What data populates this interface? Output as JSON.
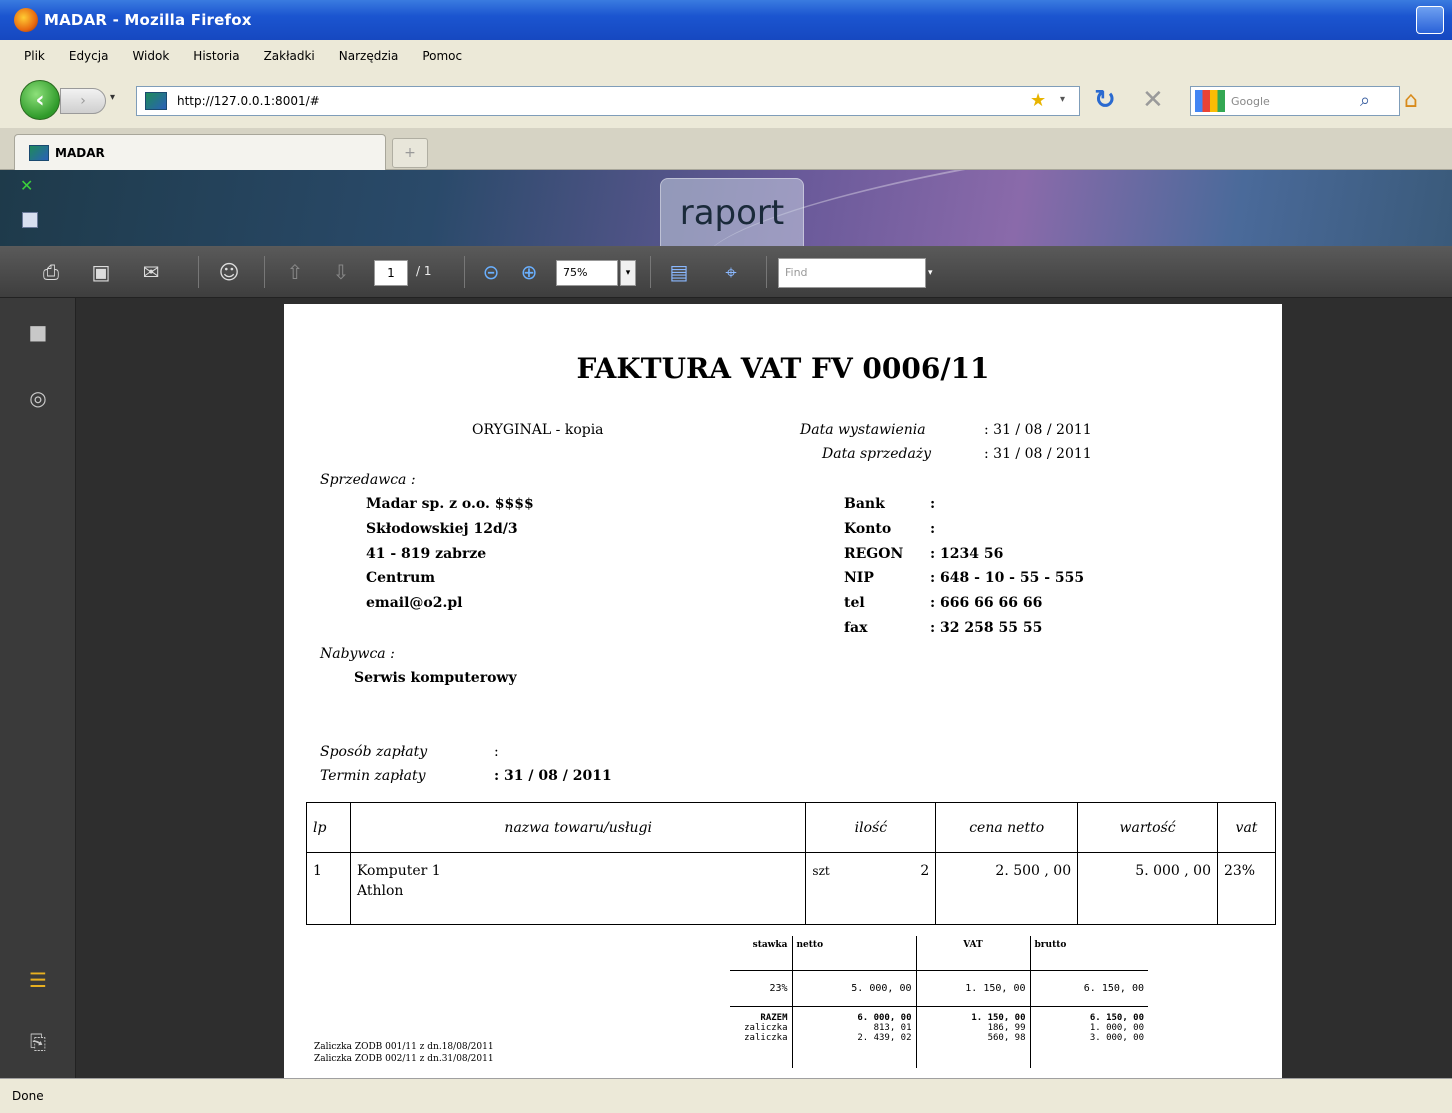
{
  "window": {
    "title": "MADAR - Mozilla Firefox"
  },
  "menu": [
    "Plik",
    "Edycja",
    "Widok",
    "Historia",
    "Zakładki",
    "Narzędzia",
    "Pomoc"
  ],
  "nav": {
    "url": "http://127.0.0.1:8001/#",
    "search_placeholder": "Google"
  },
  "tab": {
    "label": "MADAR",
    "new_tab": "+"
  },
  "app": {
    "section_title": "raport"
  },
  "pdf_toolbar": {
    "page_current": "1",
    "page_total": "/ 1",
    "zoom": "75%",
    "find_placeholder": "Find"
  },
  "invoice": {
    "title": "FAKTURA VAT FV 0006/11",
    "copy_label": "ORYGINAL   -  kopia",
    "issue_date_label": "Data wystawienia",
    "issue_date": ":  31 / 08 / 2011",
    "sale_date_label": "Data sprzedaży",
    "sale_date": ":  31 / 08 / 2011",
    "seller_label": "Sprzedawca :",
    "seller_lines": [
      "Madar sp. z o.o.  $$$$",
      "Skłodowskiej 12d/3",
      "41 - 819   zabrze",
      "Centrum",
      "email@o2.pl"
    ],
    "bank_labels": [
      "Bank",
      "Konto",
      "REGON",
      "NIP",
      "tel",
      "fax"
    ],
    "bank_values": [
      ":",
      ":",
      ":   1234 56",
      ":   648 - 10 - 55 - 555",
      ":   666   66   66   66",
      ":   32   258   55   55"
    ],
    "buyer_label": "Nabywca     :",
    "buyer_name": "Serwis komputerowy",
    "payment_method_label": "Sposób zapłaty",
    "payment_method_value": ":",
    "payment_due_label": "Termin zapłaty",
    "payment_due_value": ":   31 / 08 / 2011",
    "table_headers": [
      "lp",
      "nazwa towaru/usługi",
      "ilość",
      "cena netto",
      "wartość",
      "vat"
    ],
    "rows": [
      {
        "lp": "1",
        "name_line1": "Komputer 1",
        "name_line2": "Athlon",
        "unit": "szt",
        "qty": "2",
        "price": "2. 500 , 00",
        "value": "5. 000 , 00",
        "vat": "23%"
      }
    ],
    "summary_headers": [
      "stawka",
      "netto",
      "VAT",
      "brutto"
    ],
    "summary_rate_row": [
      "23%",
      "5. 000, 00",
      "1. 150, 00",
      "6. 150, 00"
    ],
    "summary_total_label": "RAZEM",
    "summary_totals": [
      "6. 000, 00",
      "1. 150, 00",
      "6. 150, 00"
    ],
    "advance_labels": [
      "zaliczka",
      "zaliczka"
    ],
    "advance_netto": [
      "813, 01",
      "2. 439, 02"
    ],
    "advance_vat": [
      "186, 99",
      "560, 98"
    ],
    "advance_brutto": [
      "1. 000, 00",
      "3. 000, 00"
    ],
    "advance_notes": [
      "Zaliczka ZODB 001/11 z dn.18/08/2011",
      "Zaliczka ZODB 002/11 z dn.31/08/2011"
    ]
  },
  "status": {
    "text": "Done"
  }
}
